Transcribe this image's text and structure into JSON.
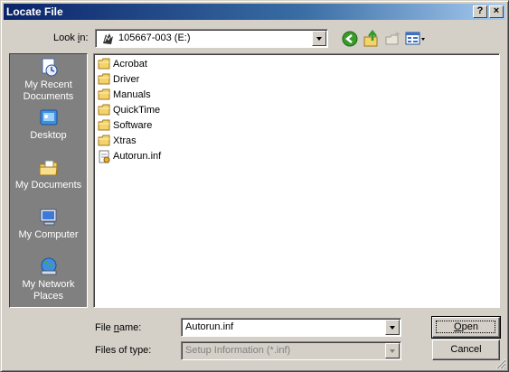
{
  "window": {
    "title": "Locate File",
    "help_label": "?",
    "close_label": "×"
  },
  "lookin": {
    "label_pre": "Look ",
    "label_u": "i",
    "label_post": "n:",
    "value": "105667-003 (E:)",
    "drive_icon": "cd-drive-icon"
  },
  "toolbar": {
    "back_icon": "back-arrow-icon",
    "up_icon": "up-folder-icon",
    "new_folder_icon": "new-folder-icon",
    "views_icon": "views-menu-icon"
  },
  "places": [
    {
      "label": "My Recent Documents",
      "icon": "recent-documents-icon"
    },
    {
      "label": "Desktop",
      "icon": "desktop-icon"
    },
    {
      "label": "My Documents",
      "icon": "my-documents-icon"
    },
    {
      "label": "My Computer",
      "icon": "my-computer-icon"
    },
    {
      "label": "My Network Places",
      "icon": "network-places-icon"
    }
  ],
  "files": [
    {
      "name": "Acrobat",
      "type": "folder"
    },
    {
      "name": "Driver",
      "type": "folder"
    },
    {
      "name": "Manuals",
      "type": "folder"
    },
    {
      "name": "QuickTime",
      "type": "folder"
    },
    {
      "name": "Software",
      "type": "folder"
    },
    {
      "name": "Xtras",
      "type": "folder"
    },
    {
      "name": "Autorun.inf",
      "type": "setup-information"
    }
  ],
  "filename": {
    "label_pre": "File ",
    "label_u": "n",
    "label_post": "ame:",
    "value": "Autorun.inf"
  },
  "filetype": {
    "label": "Files of type:",
    "value": "Setup Information (*.inf)"
  },
  "buttons": {
    "open_u": "O",
    "open_rest": "pen",
    "cancel": "Cancel"
  },
  "colors": {
    "title_gradient_start": "#0a246a",
    "title_gradient_end": "#a6caf0",
    "dialog_face": "#d4d0c8",
    "places_bar": "#808080",
    "folder_yellow": "#f4d36b"
  }
}
